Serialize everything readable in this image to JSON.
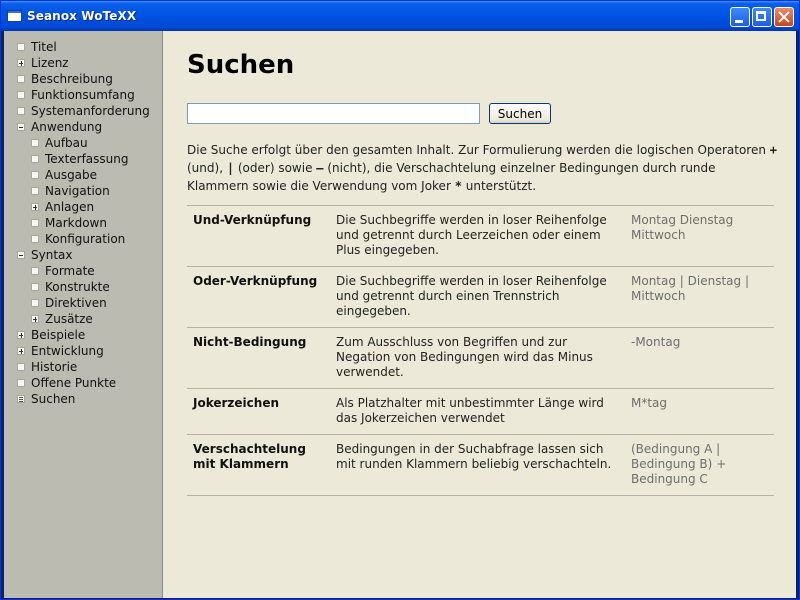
{
  "window": {
    "title": "Seanox WoTeXX",
    "accent": "#0055e5"
  },
  "sidebar": {
    "items": [
      {
        "label": "Titel",
        "icon": "leaf",
        "level": 0
      },
      {
        "label": "Lizenz",
        "icon": "plus",
        "level": 0
      },
      {
        "label": "Beschreibung",
        "icon": "leaf",
        "level": 0
      },
      {
        "label": "Funktionsumfang",
        "icon": "leaf",
        "level": 0
      },
      {
        "label": "Systemanforderung",
        "icon": "leaf",
        "level": 0
      },
      {
        "label": "Anwendung",
        "icon": "minus",
        "level": 0
      },
      {
        "label": "Aufbau",
        "icon": "leaf",
        "level": 1
      },
      {
        "label": "Texterfassung",
        "icon": "leaf",
        "level": 1
      },
      {
        "label": "Ausgabe",
        "icon": "leaf",
        "level": 1
      },
      {
        "label": "Navigation",
        "icon": "leaf",
        "level": 1
      },
      {
        "label": "Anlagen",
        "icon": "plus",
        "level": 1
      },
      {
        "label": "Markdown",
        "icon": "leaf",
        "level": 1
      },
      {
        "label": "Konfiguration",
        "icon": "leaf",
        "level": 1
      },
      {
        "label": "Syntax",
        "icon": "minus",
        "level": 0
      },
      {
        "label": "Formate",
        "icon": "leaf",
        "level": 1
      },
      {
        "label": "Konstrukte",
        "icon": "leaf",
        "level": 1
      },
      {
        "label": "Direktiven",
        "icon": "leaf",
        "level": 1
      },
      {
        "label": "Zusätze",
        "icon": "plus",
        "level": 1
      },
      {
        "label": "Beispiele",
        "icon": "plus",
        "level": 0
      },
      {
        "label": "Entwicklung",
        "icon": "plus",
        "level": 0
      },
      {
        "label": "Historie",
        "icon": "leaf",
        "level": 0
      },
      {
        "label": "Offene Punkte",
        "icon": "leaf",
        "level": 0
      },
      {
        "label": "Suchen",
        "icon": "lines",
        "level": 0
      }
    ]
  },
  "main": {
    "title": "Suchen",
    "search": {
      "value": "",
      "button_label": "Suchen"
    },
    "intro": {
      "p1": "Die Suche erfolgt über den gesamten Inhalt. Zur Formulierung werden die logischen Operatoren ",
      "op_and": "+",
      "p2": " (und), ",
      "op_or": "|",
      "p3": " (oder) sowie ",
      "op_not": "–",
      "p4": " (nicht), die Verschachtelung einzelner Bedingungen durch runde Klammern sowie die Verwendung vom Joker ",
      "op_joker": "*",
      "p5": " unterstützt."
    },
    "table": [
      {
        "term": "Und-Verknüpfung",
        "description": "Die Suchbegriffe werden in loser Reihenfolge und getrennt durch Leerzeichen oder einem Plus eingegeben.",
        "example": "Montag Dienstag Mittwoch"
      },
      {
        "term": "Oder-Verknüpfung",
        "description": "Die Suchbegriffe werden in loser Reihenfolge und getrennt durch einen Trennstrich eingegeben.",
        "example": "Montag | Dienstag | Mittwoch"
      },
      {
        "term": "Nicht-Bedingung",
        "description": "Zum Ausschluss von Begriffen und zur Negation von Bedingungen wird das Minus verwendet.",
        "example": "-Montag"
      },
      {
        "term": "Jokerzeichen",
        "description": "Als Platzhalter mit unbestimmter Länge wird das Jokerzeichen verwendet",
        "example": "M*tag"
      },
      {
        "term": "Verschachtelung mit Klammern",
        "description": "Bedingungen in der Suchabfrage lassen sich mit runden Klammern beliebig verschachteln.",
        "example": "(Bedingung A | Bedingung B) + Bedingung C"
      }
    ]
  }
}
